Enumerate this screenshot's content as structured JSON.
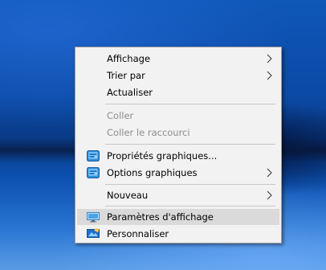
{
  "menu": {
    "items": [
      {
        "label": "Affichage"
      },
      {
        "label": "Trier par"
      },
      {
        "label": "Actualiser"
      },
      {
        "label": "Coller"
      },
      {
        "label": "Coller le raccourci"
      },
      {
        "label": "Propriétés graphiques..."
      },
      {
        "label": "Options graphiques"
      },
      {
        "label": "Nouveau"
      },
      {
        "label": "Paramètres d'affichage"
      },
      {
        "label": "Personnaliser"
      }
    ]
  },
  "colors": {
    "menu_background": "#f2f2f2",
    "highlight": "#dadada",
    "disabled_text": "#8c8c8c",
    "desktop_blue": "#0b4aa6"
  },
  "icons": {
    "graphics_properties": "intel-graphics-icon",
    "graphics_options": "intel-graphics-icon",
    "display_settings": "display-monitor-icon",
    "personalize": "personalize-icon"
  }
}
